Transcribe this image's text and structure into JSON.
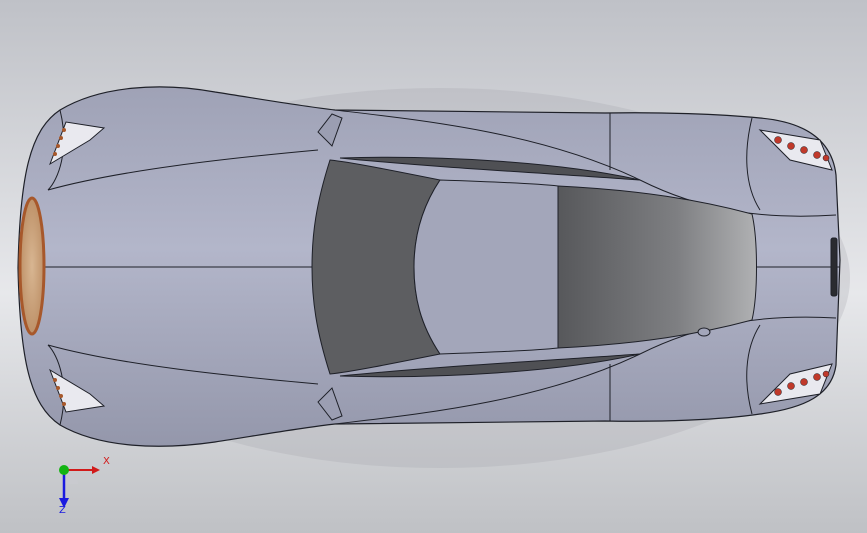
{
  "viewport": {
    "model": "car-body",
    "view_orientation": "top",
    "colors": {
      "background_light": "#e7e8eb",
      "background_dark": "#bfc1c7",
      "body": "#a9acc0",
      "body_shadow": "#8e91a6",
      "edge": "#1e2028",
      "glass_dark": "#55565a",
      "glass_light": "#a8a9ab",
      "grille": "#c8a07a",
      "grille_rim": "#a7582b",
      "tail_lamp": "#c0392b",
      "headlight": "#e9e9ef"
    }
  },
  "triad": {
    "x_label": "X",
    "z_label": "Z",
    "colors": {
      "x": "#d11a1a",
      "y": "#13b413",
      "z": "#1a1ae0"
    }
  }
}
